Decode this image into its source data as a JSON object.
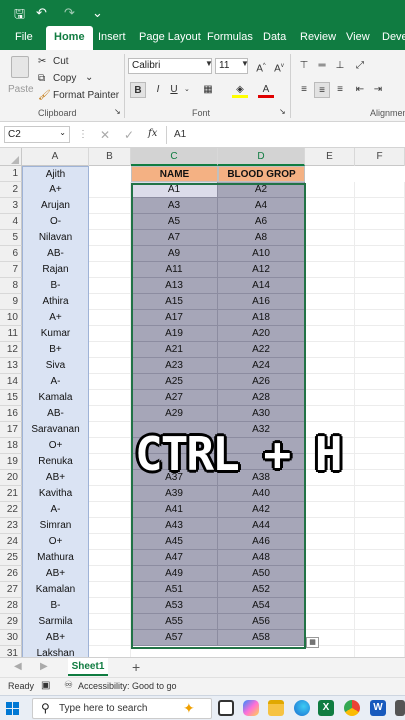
{
  "titlebar": {
    "save_icon": "save-icon",
    "undo_icon": "undo-icon",
    "redo_icon": "redo-icon",
    "more": "⌄"
  },
  "ribbon_tabs": [
    "File",
    "Home",
    "Insert",
    "Page Layout",
    "Formulas",
    "Data",
    "Review",
    "View",
    "Deve"
  ],
  "clipboard": {
    "paste": "Paste",
    "cut": "Cut",
    "copy": "Copy",
    "format_painter": "Format Painter",
    "group_label": "Clipboard"
  },
  "font": {
    "name": "Calibri",
    "size": "11",
    "bold": "B",
    "italic": "I",
    "underline": "U",
    "grow": "A^",
    "shrink": "Aˇ",
    "group_label": "Font"
  },
  "alignment": {
    "group_label": "Alignmen"
  },
  "formula_bar": {
    "name_box": "C2",
    "fx": "fx",
    "value": "A1"
  },
  "columns": [
    "A",
    "B",
    "C",
    "D",
    "E",
    "F"
  ],
  "headers": {
    "a1": "Ajith",
    "c1": "NAME",
    "d1": "BLOOD GROP"
  },
  "rows": [
    {
      "n": "2",
      "a": "A+",
      "c": "A1",
      "d": "A2"
    },
    {
      "n": "3",
      "a": "Arujan",
      "c": "A3",
      "d": "A4"
    },
    {
      "n": "4",
      "a": "O-",
      "c": "A5",
      "d": "A6"
    },
    {
      "n": "5",
      "a": "Nilavan",
      "c": "A7",
      "d": "A8"
    },
    {
      "n": "6",
      "a": "AB-",
      "c": "A9",
      "d": "A10"
    },
    {
      "n": "7",
      "a": "Rajan",
      "c": "A11",
      "d": "A12"
    },
    {
      "n": "8",
      "a": "B-",
      "c": "A13",
      "d": "A14"
    },
    {
      "n": "9",
      "a": "Athira",
      "c": "A15",
      "d": "A16"
    },
    {
      "n": "10",
      "a": "A+",
      "c": "A17",
      "d": "A18"
    },
    {
      "n": "11",
      "a": "Kumar",
      "c": "A19",
      "d": "A20"
    },
    {
      "n": "12",
      "a": "B+",
      "c": "A21",
      "d": "A22"
    },
    {
      "n": "13",
      "a": "Siva",
      "c": "A23",
      "d": "A24"
    },
    {
      "n": "14",
      "a": "A-",
      "c": "A25",
      "d": "A26"
    },
    {
      "n": "15",
      "a": "Kamala",
      "c": "A27",
      "d": "A28"
    },
    {
      "n": "16",
      "a": "AB-",
      "c": "A29",
      "d": "A30"
    },
    {
      "n": "17",
      "a": "Saravanan",
      "c": "",
      "d": "A32"
    },
    {
      "n": "18",
      "a": "O+",
      "c": "",
      "d": ""
    },
    {
      "n": "19",
      "a": "Renuka",
      "c": "",
      "d": ""
    },
    {
      "n": "20",
      "a": "AB+",
      "c": "A37",
      "d": "A38"
    },
    {
      "n": "21",
      "a": "Kavitha",
      "c": "A39",
      "d": "A40"
    },
    {
      "n": "22",
      "a": "A-",
      "c": "A41",
      "d": "A42"
    },
    {
      "n": "23",
      "a": "Simran",
      "c": "A43",
      "d": "A44"
    },
    {
      "n": "24",
      "a": "O+",
      "c": "A45",
      "d": "A46"
    },
    {
      "n": "25",
      "a": "Mathura",
      "c": "A47",
      "d": "A48"
    },
    {
      "n": "26",
      "a": "AB+",
      "c": "A49",
      "d": "A50"
    },
    {
      "n": "27",
      "a": "Kamalan",
      "c": "A51",
      "d": "A52"
    },
    {
      "n": "28",
      "a": "B-",
      "c": "A53",
      "d": "A54"
    },
    {
      "n": "29",
      "a": "Sarmila",
      "c": "A55",
      "d": "A56"
    },
    {
      "n": "30",
      "a": "AB+",
      "c": "A57",
      "d": "A58"
    },
    {
      "n": "31",
      "a": "Lakshan",
      "c": "",
      "d": ""
    }
  ],
  "overlay_text": "CTRL + H",
  "sheet_tab": "Sheet1",
  "add_sheet": "+",
  "status": {
    "ready": "Ready",
    "accessibility": "Accessibility: Good to go"
  },
  "taskbar": {
    "search_placeholder": "Type here to search"
  },
  "colors": {
    "excel_green": "#107c41",
    "header_orange": "#f4b183",
    "col_a_fill": "#dae3f3",
    "selection_fill": "#a6a6b8",
    "selection_border": "#217346"
  }
}
